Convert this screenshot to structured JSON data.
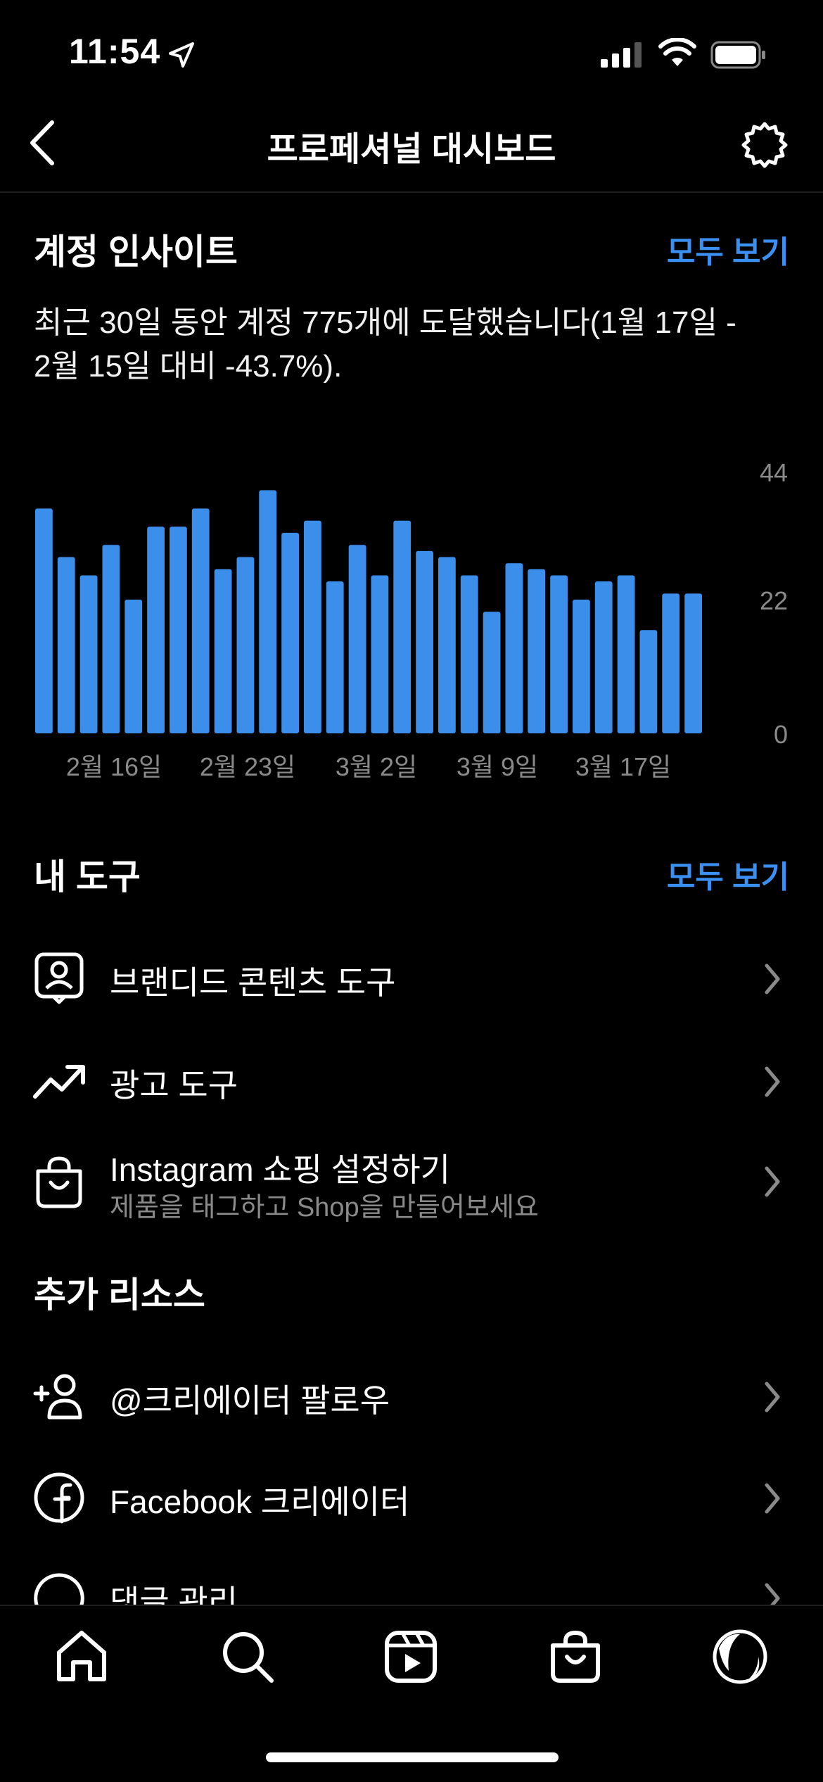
{
  "status": {
    "time": "11:54"
  },
  "nav": {
    "title": "프로페셔널 대시보드"
  },
  "insights": {
    "title": "계정 인사이트",
    "see_all": "모두 보기",
    "summary_line1": "최근 30일 동안 계정 775개에 도달했습니다(1월 17일 -",
    "summary_line2": "2월 15일 대비 -43.7%)."
  },
  "chart_data": {
    "type": "bar",
    "values": [
      37,
      29,
      26,
      31,
      22,
      34,
      34,
      37,
      27,
      29,
      40,
      33,
      35,
      25,
      31,
      26,
      35,
      30,
      29,
      26,
      20,
      28,
      27,
      26,
      22,
      25,
      26,
      17,
      23,
      23
    ],
    "ylim": [
      0,
      44
    ],
    "yticks": [
      "44",
      "22",
      "0"
    ],
    "xticks": [
      "2월 16일",
      "2월 23일",
      "3월 2일",
      "3월 9일",
      "3월 17일"
    ],
    "color": "#3c8eeb"
  },
  "tools": {
    "title": "내 도구",
    "see_all": "모두 보기",
    "items": [
      {
        "label": "브랜디드 콘텐츠 도구"
      },
      {
        "label": "광고 도구"
      },
      {
        "label": "Instagram 쇼핑 설정하기",
        "sub": "제품을 태그하고 Shop을 만들어보세요"
      }
    ]
  },
  "resources": {
    "title": "추가 리소스",
    "items": [
      {
        "label": "@크리에이터 팔로우"
      },
      {
        "label": "Facebook 크리에이터"
      },
      {
        "label": "댓글 관리"
      }
    ]
  }
}
